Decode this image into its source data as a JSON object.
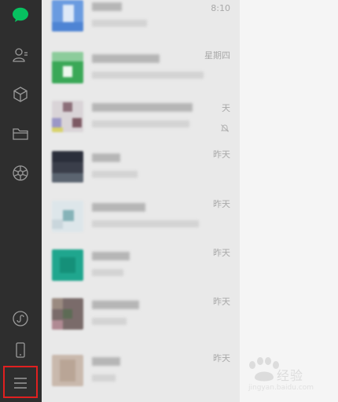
{
  "sidebar": {
    "icons": [
      "chat-icon",
      "contacts-icon",
      "favorites-icon",
      "files-icon",
      "moments-icon",
      "miniprogram-icon",
      "phone-icon",
      "menu-icon"
    ],
    "accent": "#07c160",
    "background": "#2e2e2e",
    "highlight_color": "#e02020"
  },
  "chats": [
    {
      "time": "8:10"
    },
    {
      "time": "星期四"
    },
    {
      "time": "天",
      "muted": true
    },
    {
      "time": "昨天"
    },
    {
      "time": "昨天"
    },
    {
      "time": "昨天"
    },
    {
      "time": "昨天"
    },
    {
      "time": "昨天"
    }
  ],
  "watermark": {
    "text": "经验",
    "url": "jingyan.baidu.com"
  }
}
